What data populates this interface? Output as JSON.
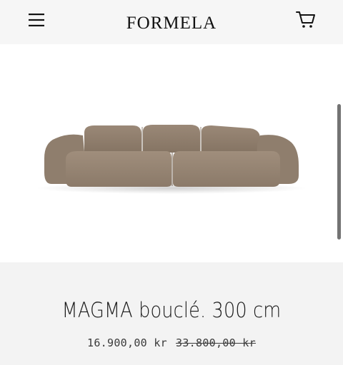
{
  "header": {
    "logo": "FORMELA",
    "icons": {
      "menu": "hamburger-menu-icon",
      "cart": "shopping-cart-icon"
    }
  },
  "product": {
    "title": "MAGMA bouclé. 300 cm",
    "price_sale": "16.900,00 kr",
    "price_original": "33.800,00 kr",
    "image": "sofa-image",
    "sofa_color": "#9a8877"
  }
}
